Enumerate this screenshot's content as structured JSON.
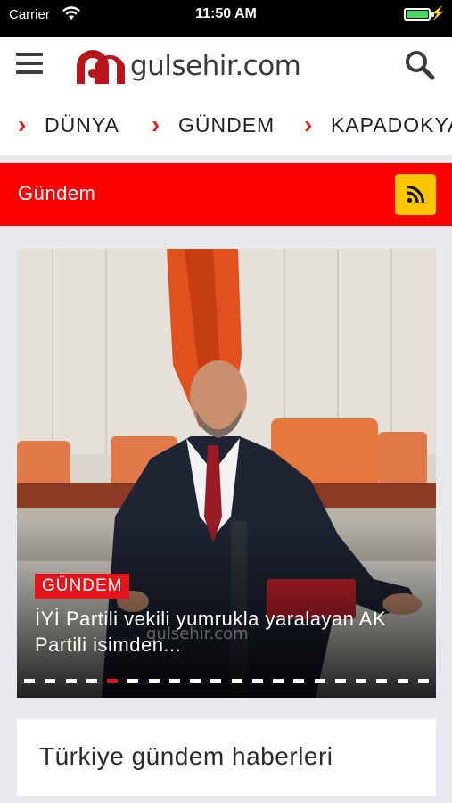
{
  "status_bar": {
    "carrier": "Carrier",
    "time": "11:50 AM",
    "battery_level": 1.0
  },
  "header": {
    "logo_text": "gulsehir.com",
    "menu_icon": "hamburger-icon",
    "search_icon": "search-icon"
  },
  "categories": [
    {
      "label": "DÜNYA"
    },
    {
      "label": "GÜNDEM"
    },
    {
      "label": "KAPADOKYA"
    }
  ],
  "section": {
    "title": "Gündem",
    "rss_icon": "rss-icon"
  },
  "slider": {
    "badge": "GÜNDEM",
    "headline": "İYİ Partili vekili yumrukla yaralayan AK Partili isimden...",
    "watermark": "gulsehir.com",
    "slide_count": 20,
    "active_index": 4
  },
  "box": {
    "title": "Türkiye gündem haberleri"
  },
  "colors": {
    "brand_red": "#ff0000",
    "badge_red": "#e8121a",
    "rss_yellow": "#f9c600",
    "logo_red": "#b8141c"
  }
}
